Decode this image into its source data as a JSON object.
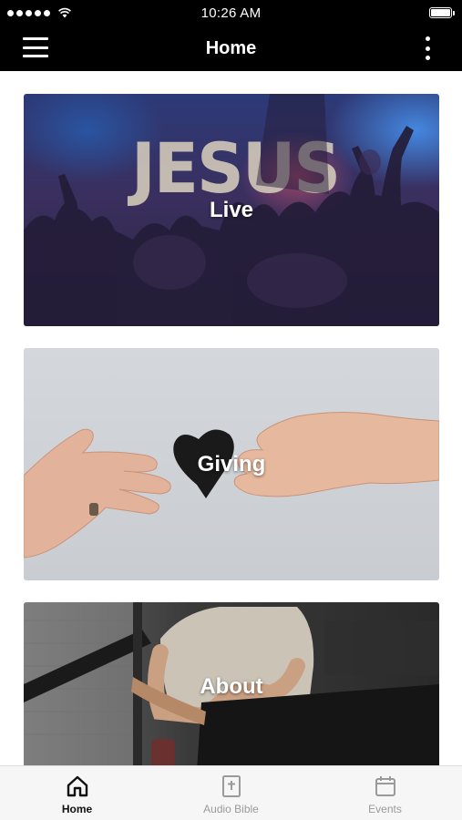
{
  "status_bar": {
    "time": "10:26 AM"
  },
  "nav": {
    "title": "Home"
  },
  "cards": [
    {
      "label": "Live",
      "image_text": "JESUS"
    },
    {
      "label": "Giving"
    },
    {
      "label": "About"
    }
  ],
  "tabs": [
    {
      "label": "Home",
      "icon": "home-icon",
      "active": true
    },
    {
      "label": "Audio Bible",
      "icon": "bible-icon",
      "active": false
    },
    {
      "label": "Events",
      "icon": "calendar-icon",
      "active": false
    }
  ],
  "colors": {
    "bar_background": "#000000",
    "tab_active": "#111111",
    "tab_inactive": "#9a9a9a"
  }
}
